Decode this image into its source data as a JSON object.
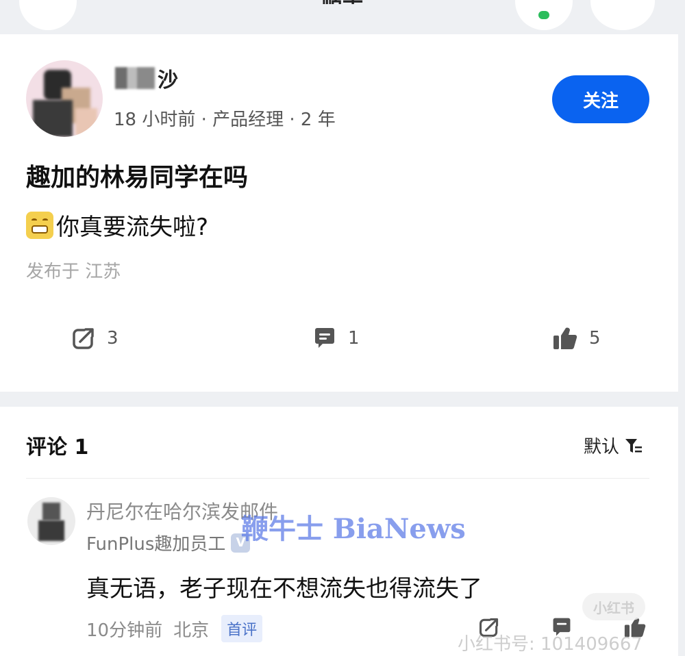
{
  "topbar": {
    "title": "帖子"
  },
  "post": {
    "author_name": "沙",
    "meta": "18 小时前 · 产品经理 · 2 年",
    "follow_label": "关注",
    "title": "趣加的林易同学在吗",
    "body": "你真要流失啦?",
    "location": "发布于 江苏",
    "share_count": "3",
    "comment_count": "1",
    "like_count": "5"
  },
  "comments": {
    "header": "评论 1",
    "sort_label": "默认",
    "items": [
      {
        "name": "丹尼尔在哈尔滨发邮件",
        "role": "FunPlus趣加员工",
        "badge": "V",
        "text": "真无语，老子现在不想流失也得流失了",
        "time": "10分钟前",
        "location": "北京",
        "tag": "首评"
      }
    ]
  },
  "watermark": "鞭牛士 BiaNews",
  "xhs": {
    "badge": "小红书",
    "id": "小红书号: 101409667"
  },
  "colors": {
    "accent": "#0a63f0",
    "background": "#eef0f3",
    "watermark": "#5a78e6"
  }
}
